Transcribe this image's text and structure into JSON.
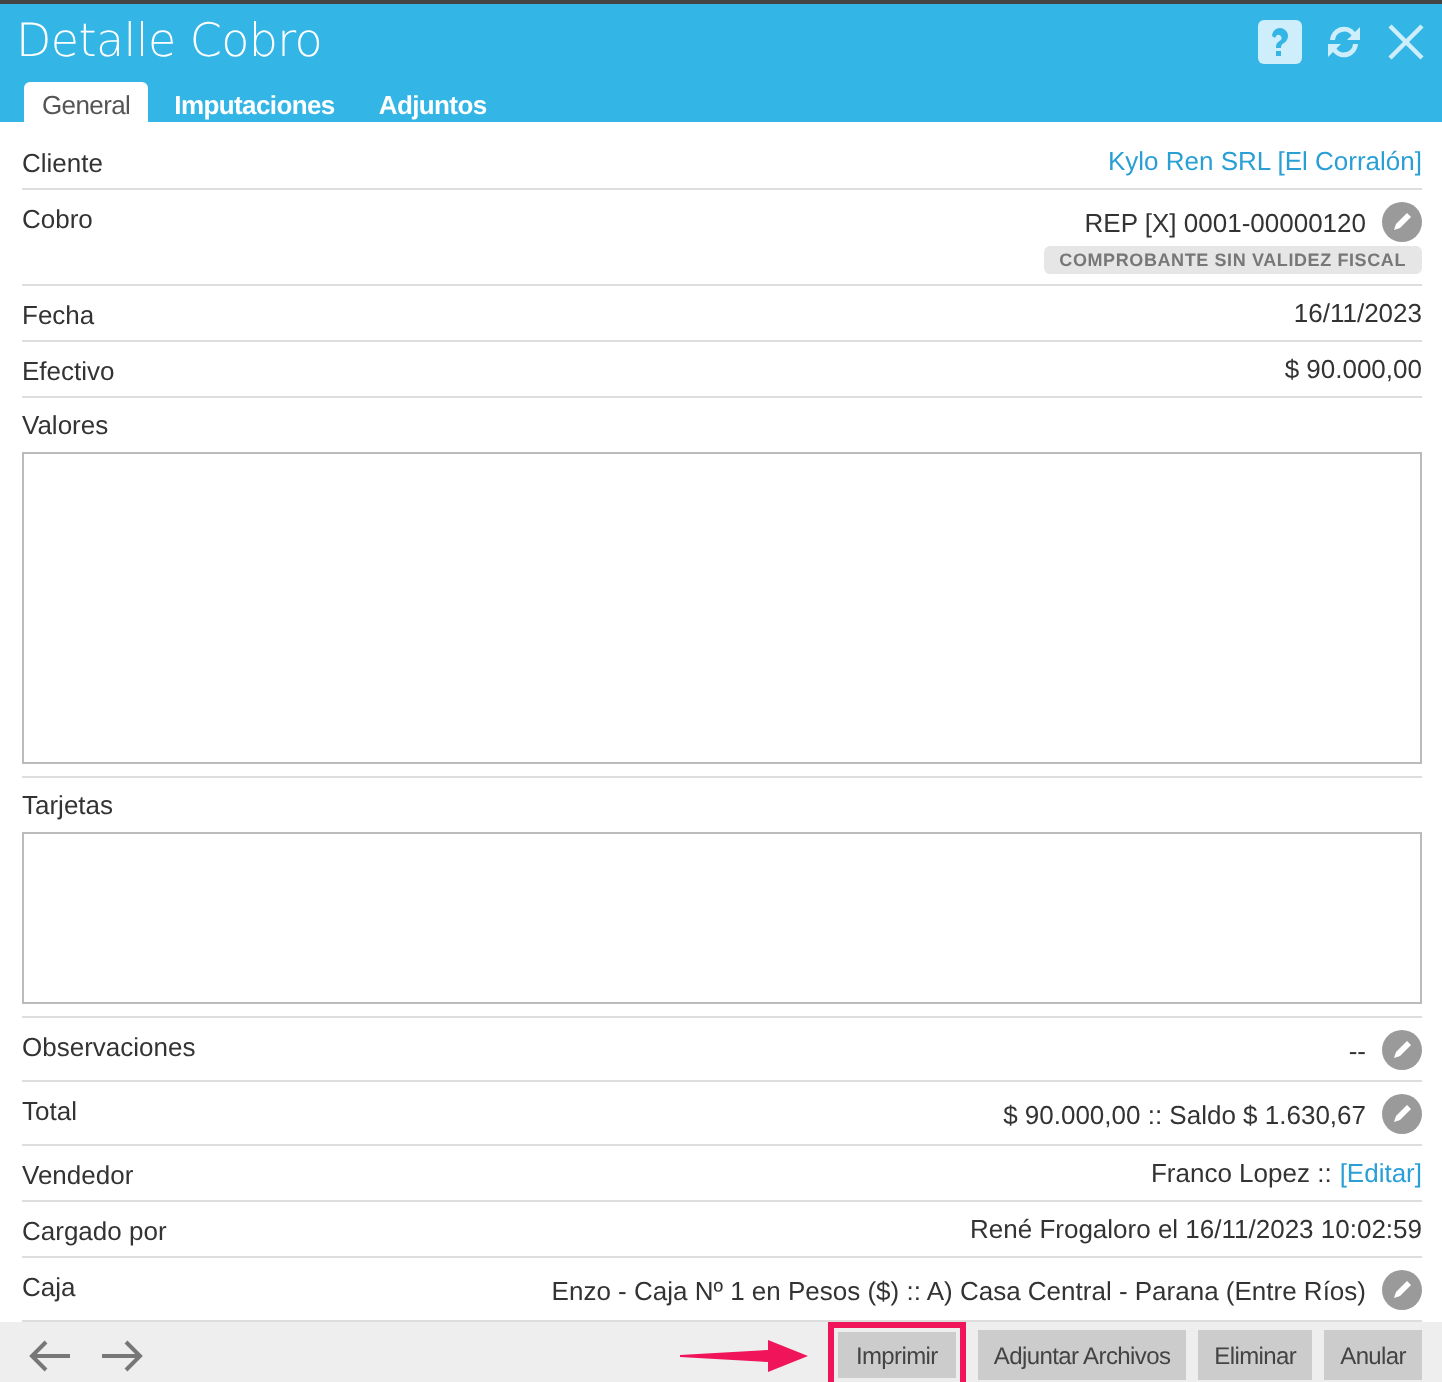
{
  "window": {
    "title": "Detalle Cobro"
  },
  "tabs": [
    {
      "label": "General",
      "selected": true
    },
    {
      "label": "Imputaciones",
      "selected": false
    },
    {
      "label": "Adjuntos",
      "selected": false
    }
  ],
  "rows": [
    {
      "kind": "field",
      "label": "Cliente",
      "value": "Kylo Ren SRL [El Corralón]",
      "link": true,
      "editable": false
    },
    {
      "kind": "field",
      "label": "Cobro",
      "value": "REP [X] 0001-00000120",
      "link": false,
      "editable": true,
      "badge": "COMPROBANTE SIN VALIDEZ FISCAL"
    },
    {
      "kind": "field",
      "label": "Fecha",
      "value": "16/11/2023",
      "link": false,
      "editable": false
    },
    {
      "kind": "field",
      "label": "Efectivo",
      "value": "$ 90.000,00",
      "link": false,
      "editable": false
    },
    {
      "kind": "box",
      "label": "Valores"
    },
    {
      "kind": "box",
      "label": "Tarjetas"
    },
    {
      "kind": "field",
      "label": "Observaciones",
      "value": "--",
      "link": false,
      "editable": true
    },
    {
      "kind": "field",
      "label": "Total",
      "value": "$ 90.000,00 :: Saldo $ 1.630,67",
      "link": false,
      "editable": true
    },
    {
      "kind": "field",
      "label": "Vendedor",
      "value": "Franco Lopez ::",
      "action": "[Editar]",
      "link": false,
      "editable": false
    },
    {
      "kind": "field",
      "label": "Cargado por",
      "value": "René Frogaloro el 16/11/2023 10:02:59",
      "link": false,
      "editable": false
    },
    {
      "kind": "field",
      "label": "Caja",
      "value": "Enzo - Caja Nº 1 en Pesos ($) :: A) Casa Central - Parana (Entre Ríos)",
      "link": false,
      "editable": true
    }
  ],
  "footer": {
    "buttons": [
      {
        "label": "Imprimir",
        "highlighted": true
      },
      {
        "label": "Adjuntar Archivos",
        "highlighted": false
      },
      {
        "label": "Eliminar",
        "highlighted": false
      },
      {
        "label": "Anular",
        "highlighted": false
      }
    ]
  }
}
